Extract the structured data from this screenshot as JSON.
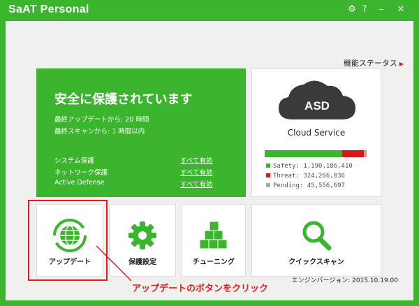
{
  "titlebar": {
    "app_name": "SaAT Personal",
    "settings_icon": "gear-icon",
    "help_label": "?",
    "minimize_label": "–",
    "close_label": "✕"
  },
  "status_link": {
    "label": "機能ステータス"
  },
  "protection": {
    "headline": "安全に保護されています",
    "last_update": "最終アップデートから: 20 時間",
    "last_scan": "最終スキャンから: 1 時間以内",
    "rows": [
      {
        "label": "システム保護",
        "value": "すべて有効"
      },
      {
        "label": "ネットワーク保護",
        "value": "すべて有効"
      },
      {
        "label": "Active Defense",
        "value": "すべて有効"
      }
    ]
  },
  "cloud": {
    "badge": "ASD",
    "label": "Cloud Service",
    "safety": "Safety: 1,190,186,410",
    "threat": "Threat: 324,266,036",
    "pending": "Pending: 45,556,697",
    "shares": {
      "safety": 0.76,
      "threat": 0.21,
      "pending": 0.03
    },
    "colors": {
      "safety": "#3cb52e",
      "threat": "#d7191a",
      "pending": "#aaaaaa"
    }
  },
  "tiles": [
    {
      "label": "アップデート",
      "icon": "globe-refresh-icon"
    },
    {
      "label": "保護設定",
      "icon": "gear-icon"
    },
    {
      "label": "チューニング",
      "icon": "blocks-icon"
    },
    {
      "label": "クイックスキャン",
      "icon": "magnifier-icon"
    }
  ],
  "engine_version": "エンジンバージョン: 2015.10.19.00",
  "annotation": {
    "text": "アップデートのボタンをクリック"
  },
  "colors": {
    "brand": "#3cb52e",
    "annotation": "#e31c1c"
  }
}
